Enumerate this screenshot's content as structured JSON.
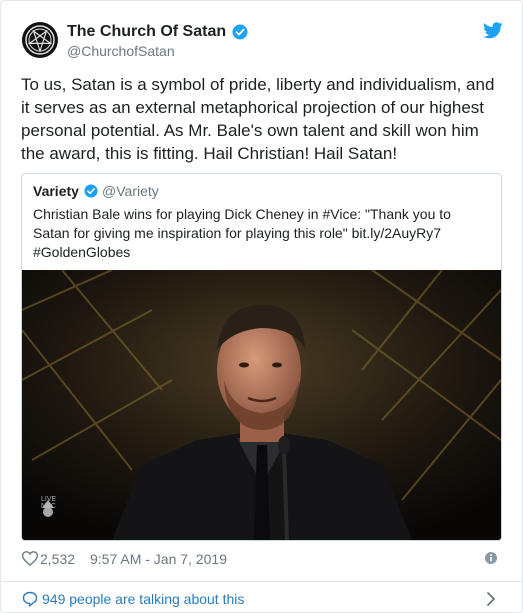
{
  "tweet": {
    "author_name": "The Church Of Satan",
    "author_handle": "@ChurchofSatan",
    "text": "To us, Satan is a symbol of pride, liberty and individualism, and it serves as an external metaphorical projection of our highest personal potential. As Mr. Bale's own talent and skill won him the award, this is fitting. Hail Christian! Hail Satan!",
    "likes": "2,532",
    "timestamp": "9:57 AM - Jan 7, 2019",
    "conversation": "949 people are talking about this"
  },
  "quoted": {
    "author_name": "Variety",
    "author_handle": "@Variety",
    "text_lines": [
      "Christian Bale wins for playing Dick Cheney in #Vice: \"Thank you to",
      "Satan for giving me inspiration for playing this role\" bit.ly/2AuyRy7",
      "#GoldenGlobes"
    ],
    "watermark": "LIVE NBC"
  },
  "colors": {
    "verified": "#1da1f2",
    "twitter_blue": "#1da1f2",
    "link": "#2b7bb9",
    "meta": "#697882"
  },
  "icons": {
    "avatar": "pentagram-seal-icon",
    "verified": "verified-badge-icon",
    "brand": "twitter-bird-icon",
    "likes": "heart-icon",
    "info": "info-icon",
    "conversation": "speech-bubble-icon",
    "more": "chevron-right-icon"
  }
}
